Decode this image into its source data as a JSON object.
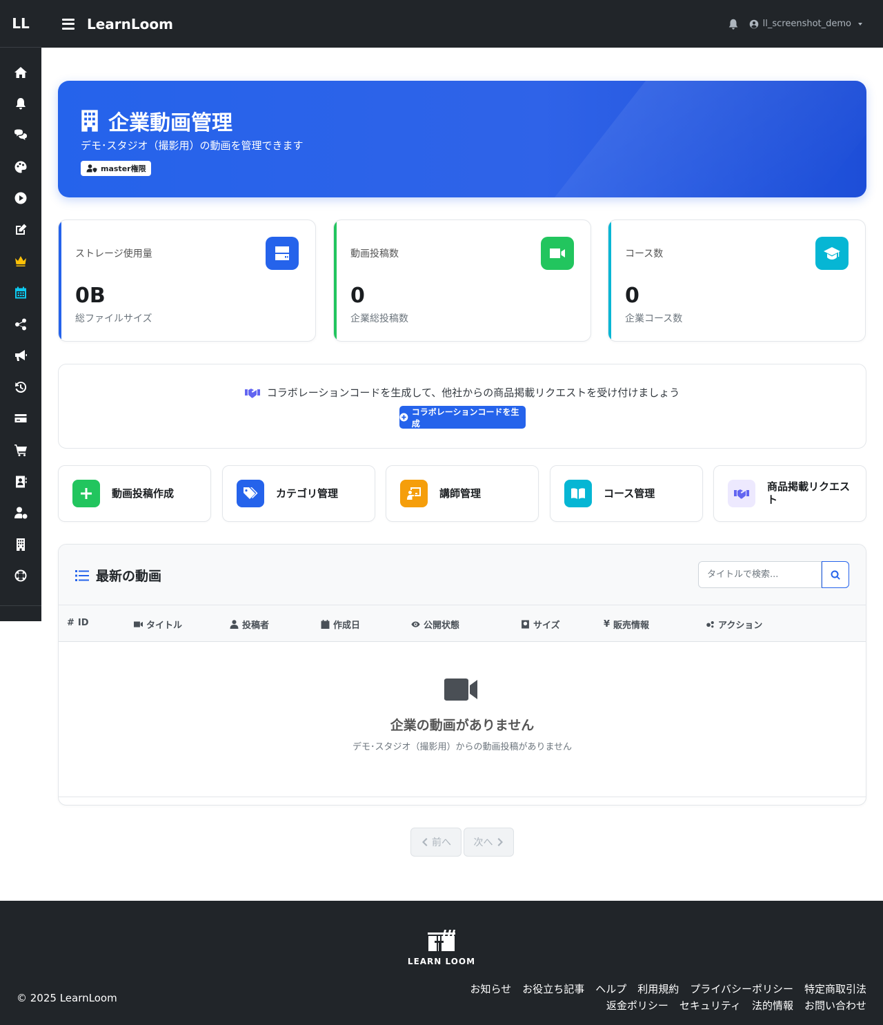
{
  "app": {
    "short_brand": "LL",
    "title": "LearnLoom"
  },
  "topbar": {
    "username": "ll_screenshot_demo"
  },
  "sidebar": {
    "icons": [
      "home-icon",
      "bell-icon",
      "chat-icon",
      "palette-icon",
      "play-icon",
      "edit-icon",
      "crown-icon",
      "calendar-icon",
      "share-icon",
      "megaphone-icon",
      "history-icon",
      "card-icon",
      "cart-icon",
      "contact-icon",
      "user-gear-icon",
      "building-icon",
      "lifebuoy-icon"
    ]
  },
  "hero": {
    "title": "企業動画管理",
    "subtitle": "デモ･スタジオ（撮影用）の動画を管理できます",
    "badge": "master権限"
  },
  "stats": [
    {
      "label": "ストレージ使用量",
      "value": "0B",
      "desc": "総ファイルサイズ",
      "color": "#2563eb"
    },
    {
      "label": "動画投稿数",
      "value": "0",
      "desc": "企業総投稿数",
      "color": "#22c55e"
    },
    {
      "label": "コース数",
      "value": "0",
      "desc": "企業コース数",
      "color": "#06b6d4"
    }
  ],
  "collab": {
    "text": "コラボレーションコードを生成して、他社からの商品掲載リクエストを受け付けましょう",
    "button": "コラボレーションコードを生成"
  },
  "tiles": [
    {
      "label": "動画投稿作成",
      "color": "#22c55e"
    },
    {
      "label": "カテゴリ管理",
      "color": "#2563eb"
    },
    {
      "label": "講師管理",
      "color": "#f59e0b"
    },
    {
      "label": "コース管理",
      "color": "#06b6d4"
    },
    {
      "label": "商品掲載リクエスト",
      "color": "#ede9fe"
    }
  ],
  "videos": {
    "title": "最新の動画",
    "search_placeholder": "タイトルで検索...",
    "columns": [
      "ID",
      "タイトル",
      "投稿者",
      "作成日",
      "公開状態",
      "サイズ",
      "販売情報",
      "アクション"
    ],
    "empty_title": "企業の動画がありません",
    "empty_sub": "デモ･スタジオ（撮影用）からの動画投稿がありません"
  },
  "pagination": {
    "prev": "前へ",
    "next": "次へ"
  },
  "footer": {
    "logo_text": "LEARN LOOM",
    "copyright": "© 2025 LearnLoom",
    "links": [
      "お知らせ",
      "お役立ち記事",
      "ヘルプ",
      "利用規約",
      "プライバシーポリシー",
      "特定商取引法",
      "返金ポリシー",
      "セキュリティ",
      "法的情報",
      "お問い合わせ"
    ]
  }
}
